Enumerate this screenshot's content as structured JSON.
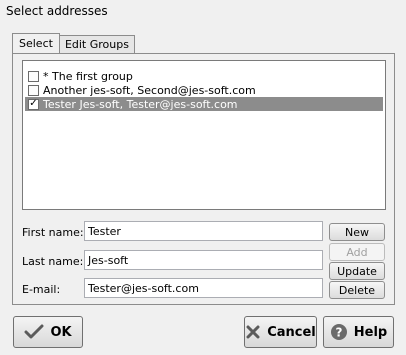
{
  "window": {
    "title": "Select addresses"
  },
  "tabs": [
    {
      "label": "Select"
    },
    {
      "label": "Edit Groups"
    }
  ],
  "address_list": {
    "items": [
      {
        "label": "* The first group",
        "checked": false,
        "check_mark": ""
      },
      {
        "label": "Another jes-soft, Second@jes-soft.com",
        "checked": false,
        "check_mark": ""
      },
      {
        "label": "Tester Jes-soft, Tester@jes-soft.com",
        "checked": true,
        "check_mark": "✓"
      }
    ]
  },
  "form": {
    "first_name": {
      "label": "First name:",
      "value": "Tester"
    },
    "last_name": {
      "label": "Last name:",
      "value": "Jes-soft"
    },
    "email": {
      "label": "E-mail:",
      "value": "Tester@jes-soft.com"
    }
  },
  "side_buttons": {
    "new": "New",
    "add": "Add",
    "update": "Update",
    "delete": "Delete"
  },
  "footer": {
    "ok": "OK",
    "cancel": "Cancel",
    "help": "Help"
  },
  "icons": {
    "ok": "check-icon",
    "cancel": "x-icon",
    "help": "question-icon"
  }
}
